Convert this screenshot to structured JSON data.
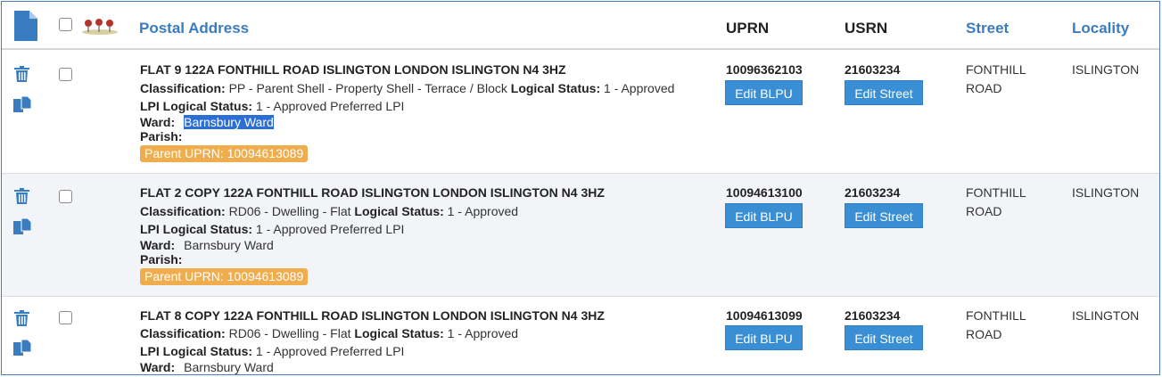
{
  "header": {
    "postal_address": "Postal Address",
    "uprn": "UPRN",
    "usrn": "USRN",
    "street": "Street",
    "locality": "Locality"
  },
  "labels": {
    "classification": "Classification:",
    "logical_status": "Logical Status:",
    "lpi_logical_status": "LPI Logical Status:",
    "ward": "Ward:",
    "parish": "Parish:",
    "edit_blpu": "Edit BLPU",
    "edit_street": "Edit Street"
  },
  "rows": [
    {
      "address": "FLAT 9 122A FONTHILL ROAD ISLINGTON LONDON ISLINGTON N4 3HZ",
      "classification": "PP - Parent Shell - Property Shell - Terrace / Block",
      "logical_status": "1 - Approved",
      "lpi_logical_status": "1 - Approved Preferred LPI",
      "ward": "Barnsbury Ward",
      "parish": "",
      "parent_uprn": "Parent UPRN: 10094613089",
      "uprn": "10096362103",
      "usrn": "21603234",
      "street_line1": "FONTHILL",
      "street_line2": "ROAD",
      "locality": "ISLINGTON"
    },
    {
      "address": "FLAT 2 COPY 122A FONTHILL ROAD ISLINGTON LONDON ISLINGTON N4 3HZ",
      "classification": "RD06 - Dwelling - Flat",
      "logical_status": "1 - Approved",
      "lpi_logical_status": "1 - Approved Preferred LPI",
      "ward": "Barnsbury Ward",
      "parish": "",
      "parent_uprn": "Parent UPRN: 10094613089",
      "uprn": "10094613100",
      "usrn": "21603234",
      "street_line1": "FONTHILL",
      "street_line2": "ROAD",
      "locality": "ISLINGTON"
    },
    {
      "address": "FLAT 8 COPY 122A FONTHILL ROAD ISLINGTON LONDON ISLINGTON N4 3HZ",
      "classification": "RD06 - Dwelling - Flat",
      "logical_status": "1 - Approved",
      "lpi_logical_status": "1 - Approved Preferred LPI",
      "ward": "Barnsbury Ward",
      "uprn": "10094613099",
      "usrn": "21603234",
      "street_line1": "FONTHILL",
      "street_line2": "ROAD",
      "locality": "ISLINGTON"
    }
  ],
  "colors": {
    "accent": "#3a7cc0",
    "button": "#3a8ed3",
    "badge": "#f0ad4e",
    "selection": "#2b6fd6",
    "alt_row": "#f2f4f7"
  },
  "icons": [
    "document-icon",
    "map-pins-icon",
    "trash-icon",
    "copy-icon"
  ]
}
